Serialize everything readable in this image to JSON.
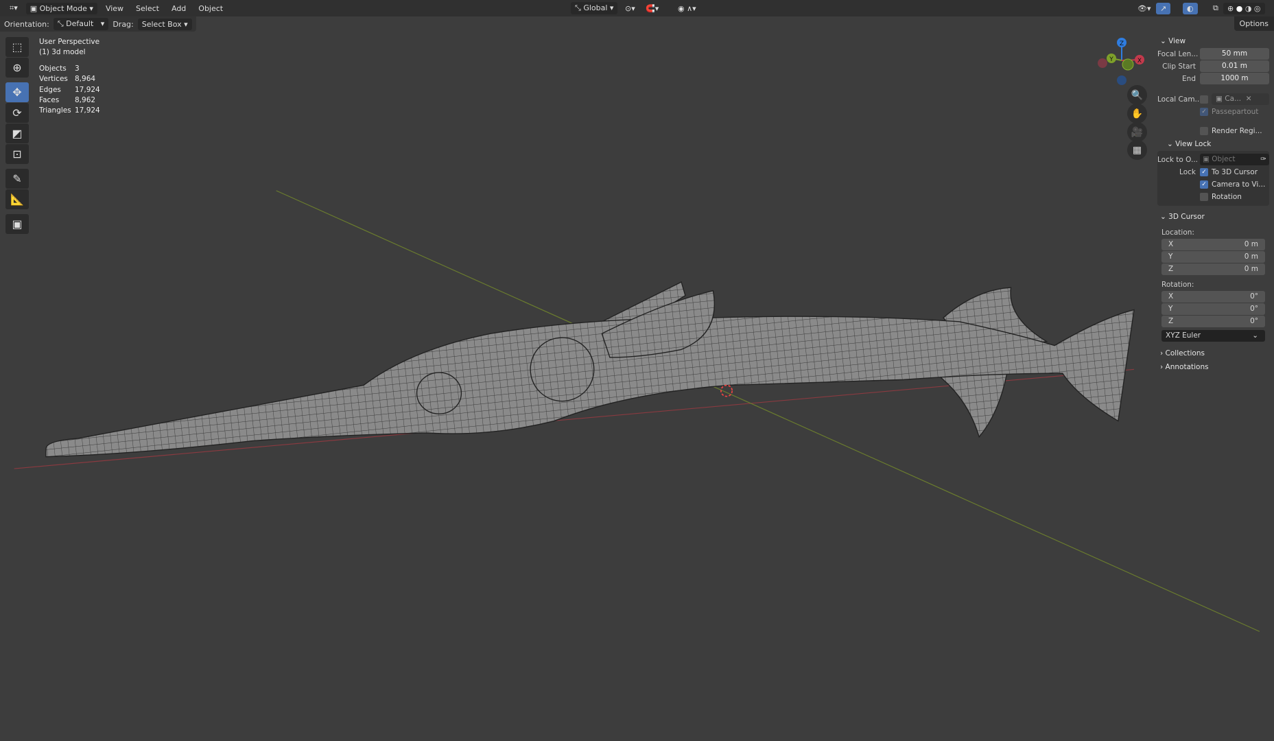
{
  "topbar": {
    "editor_icon": "editor-type-icon",
    "mode": "Object Mode",
    "menus": [
      "View",
      "Select",
      "Add",
      "Object"
    ],
    "transform_orientation": "Global"
  },
  "header2": {
    "orientation_label": "Orientation:",
    "orientation_value": "Default",
    "drag_label": "Drag:",
    "drag_value": "Select Box",
    "options": "Options"
  },
  "overlay": {
    "view_name": "User Perspective",
    "object_name": "(1) 3d model",
    "stats": [
      {
        "label": "Objects",
        "value": "3"
      },
      {
        "label": "Vertices",
        "value": "8,964"
      },
      {
        "label": "Edges",
        "value": "17,924"
      },
      {
        "label": "Faces",
        "value": "8,962"
      },
      {
        "label": "Triangles",
        "value": "17,924"
      }
    ]
  },
  "gizmo": {
    "x": "X",
    "y": "Y",
    "z": "Z",
    "colors": {
      "x": "#c33a4c",
      "y": "#7ea02a",
      "z": "#2f7de0"
    }
  },
  "npanel": {
    "view": {
      "title": "View",
      "focal_label": "Focal Len...",
      "focal": "50 mm",
      "clip_start_label": "Clip Start",
      "clip_start": "0.01 m",
      "end_label": "End",
      "end": "1000 m",
      "local_cam_label": "Local Cam...",
      "local_cam_value": "Ca...",
      "passepartout": "Passepartout",
      "render_region": "Render Regi..."
    },
    "view_lock": {
      "title": "View Lock",
      "lock_to_label": "Lock to O...",
      "lock_to_placeholder": "Object",
      "lock_label": "Lock",
      "to_cursor": "To 3D Cursor",
      "camera_to_view": "Camera to Vi...",
      "rotation": "Rotation"
    },
    "cursor": {
      "title": "3D Cursor",
      "location_label": "Location:",
      "loc": [
        {
          "axis": "X",
          "value": "0 m"
        },
        {
          "axis": "Y",
          "value": "0 m"
        },
        {
          "axis": "Z",
          "value": "0 m"
        }
      ],
      "rotation_label": "Rotation:",
      "rot": [
        {
          "axis": "X",
          "value": "0°"
        },
        {
          "axis": "Y",
          "value": "0°"
        },
        {
          "axis": "Z",
          "value": "0°"
        }
      ],
      "rotation_mode": "XYZ Euler"
    },
    "collections": "Collections",
    "annotations": "Annotations"
  },
  "accent": "#4772b3"
}
